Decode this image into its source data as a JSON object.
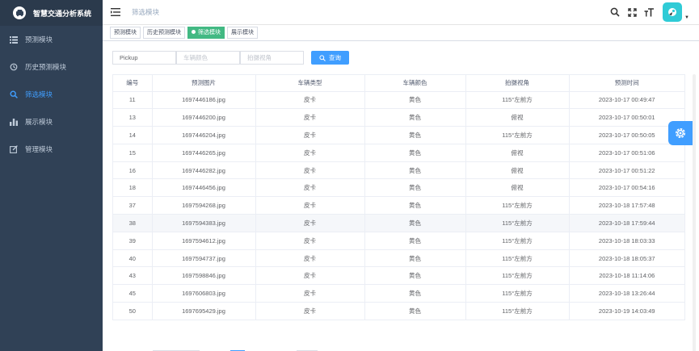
{
  "app": {
    "title": "智慧交通分析系统",
    "accent": "#409eff"
  },
  "sidebar": {
    "items": [
      {
        "label": "预测模块",
        "icon": "list-icon",
        "active": false
      },
      {
        "label": "历史预测模块",
        "icon": "history-icon",
        "active": false
      },
      {
        "label": "筛选模块",
        "icon": "search-icon",
        "active": true
      },
      {
        "label": "展示模块",
        "icon": "bar-chart-icon",
        "active": false
      },
      {
        "label": "管理模块",
        "icon": "edit-icon",
        "active": false
      }
    ]
  },
  "header": {
    "breadcrumb": "筛选模块"
  },
  "tags": [
    {
      "label": "预测模块",
      "active": false
    },
    {
      "label": "历史预测模块",
      "active": false
    },
    {
      "label": "筛选模块",
      "active": true
    },
    {
      "label": "展示模块",
      "active": false
    }
  ],
  "search": {
    "field1_value": "Pickup",
    "field2_placeholder": "车辆颜色",
    "field3_placeholder": "拍摄视角",
    "button_label": "查询"
  },
  "table": {
    "columns": [
      "编号",
      "预测图片",
      "车辆类型",
      "车辆颜色",
      "拍摄视角",
      "预测时间"
    ],
    "rows": [
      [
        "11",
        "1697446186.jpg",
        "皮卡",
        "黄色",
        "115°左前方",
        "2023-10-17 00:49:47"
      ],
      [
        "13",
        "1697446200.jpg",
        "皮卡",
        "黄色",
        "俯视",
        "2023-10-17 00:50:01"
      ],
      [
        "14",
        "1697446204.jpg",
        "皮卡",
        "黄色",
        "115°左前方",
        "2023-10-17 00:50:05"
      ],
      [
        "15",
        "1697446265.jpg",
        "皮卡",
        "黄色",
        "俯视",
        "2023-10-17 00:51:06"
      ],
      [
        "16",
        "1697446282.jpg",
        "皮卡",
        "黄色",
        "俯视",
        "2023-10-17 00:51:22"
      ],
      [
        "18",
        "1697446456.jpg",
        "皮卡",
        "黄色",
        "俯视",
        "2023-10-17 00:54:16"
      ],
      [
        "37",
        "1697594268.jpg",
        "皮卡",
        "黄色",
        "115°左前方",
        "2023-10-18 17:57:48"
      ],
      [
        "38",
        "1697594383.jpg",
        "皮卡",
        "黄色",
        "115°左前方",
        "2023-10-18 17:59:44"
      ],
      [
        "39",
        "1697594612.jpg",
        "皮卡",
        "黄色",
        "115°左前方",
        "2023-10-18 18:03:33"
      ],
      [
        "40",
        "1697594737.jpg",
        "皮卡",
        "黄色",
        "115°左前方",
        "2023-10-18 18:05:37"
      ],
      [
        "43",
        "1697598846.jpg",
        "皮卡",
        "黄色",
        "115°左前方",
        "2023-10-18 11:14:06"
      ],
      [
        "45",
        "1697606803.jpg",
        "皮卡",
        "黄色",
        "115°左前方",
        "2023-10-18 13:26:44"
      ],
      [
        "50",
        "1697695429.jpg",
        "皮卡",
        "黄色",
        "115°左前方",
        "2023-10-19 14:03:49"
      ]
    ],
    "highlighted_row": 7
  }
}
